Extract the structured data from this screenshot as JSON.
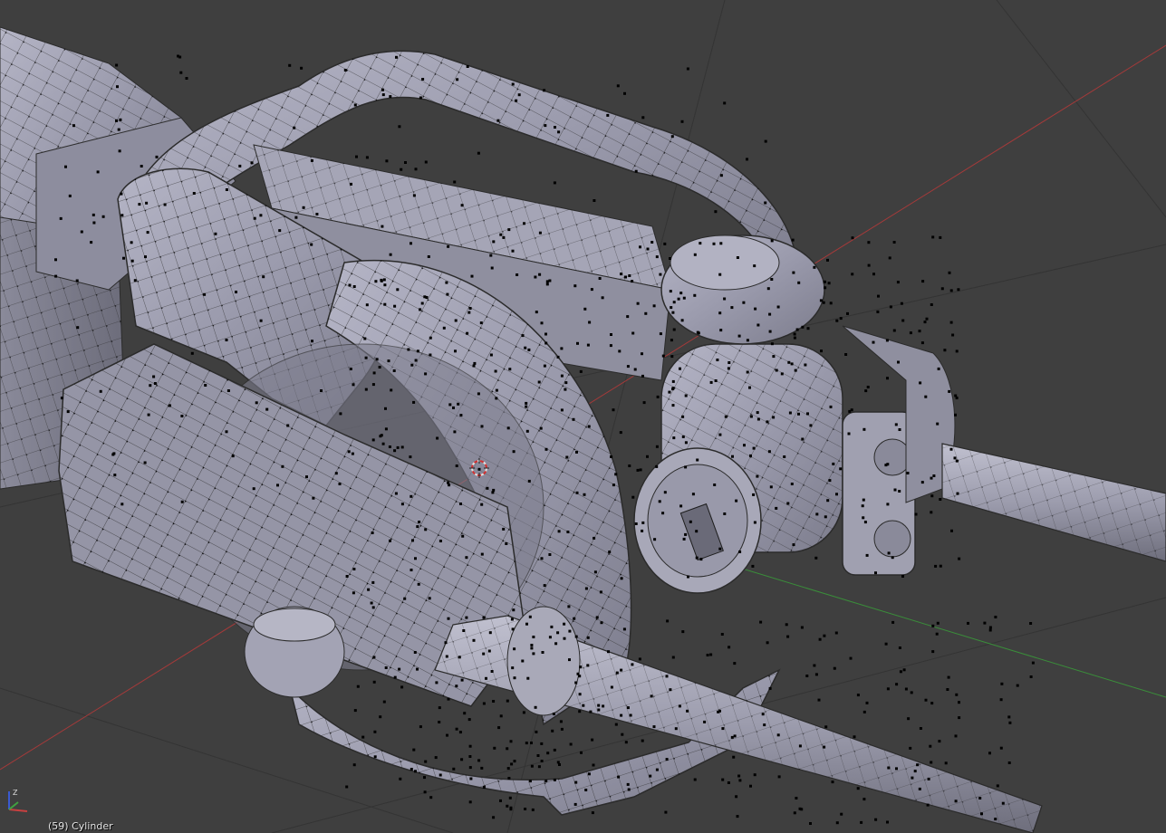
{
  "viewport": {
    "object_status": "(59) Cylinder",
    "grid_color": "#2f2f2f",
    "axis_x_color": "#b03a3a",
    "axis_y_color": "#3a9a3a",
    "mesh_fill": "#9e9eb0",
    "mesh_edge": "#2b2b2b",
    "vertex_color": "#000000"
  },
  "axis_widget": {
    "x_icon": "x-axis-icon",
    "y_icon": "y-axis-icon",
    "z_icon": "z-axis-icon",
    "z_label": "Z",
    "x_label": "X"
  }
}
